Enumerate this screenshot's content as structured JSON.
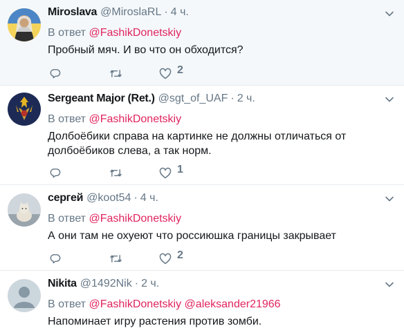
{
  "tweets": [
    {
      "name": "Miroslava",
      "handle": "@MiroslaRL",
      "time": "4 ч.",
      "reply_prefix": "В ответ",
      "mentions": [
        "@FashikDonetskiy"
      ],
      "text": "Пробный мяч. И во что он обходится?",
      "likes": "2",
      "highlighted": true,
      "avatar": "woman-in-headscarf-icon"
    },
    {
      "name": "Sergeant Major (Ret.)",
      "handle": "@sgt_of_UAF",
      "time": "2 ч.",
      "reply_prefix": "В ответ",
      "mentions": [
        "@FashikDonetskiy"
      ],
      "text": "Долбоёбики справа на картинке не должны отличаться от долбоёбиков слева, а так норм.",
      "likes": "1",
      "highlighted": false,
      "avatar": "military-emblem-icon"
    },
    {
      "name": "сергей",
      "handle": "@koot54",
      "time": "4 ч.",
      "reply_prefix": "В ответ",
      "mentions": [
        "@FashikDonetskiy"
      ],
      "text": "А они там не охуеют что россиюшка границы закрывает",
      "likes": "2",
      "highlighted": false,
      "avatar": "cat-photo-icon"
    },
    {
      "name": "Nikita",
      "handle": "@1492Nik",
      "time": "2 ч.",
      "reply_prefix": "В ответ",
      "mentions": [
        "@FashikDonetskiy",
        "@aleksander21966"
      ],
      "text": "Напоминает игру растения против зомби.",
      "likes": "",
      "highlighted": false,
      "avatar": "default-profile-icon"
    }
  ],
  "colors": {
    "mention": "#e0245e",
    "secondary": "#657786",
    "primary_text": "#14171a",
    "highlight_bg": "#f5f8fa",
    "divider": "#e6ecf0"
  }
}
